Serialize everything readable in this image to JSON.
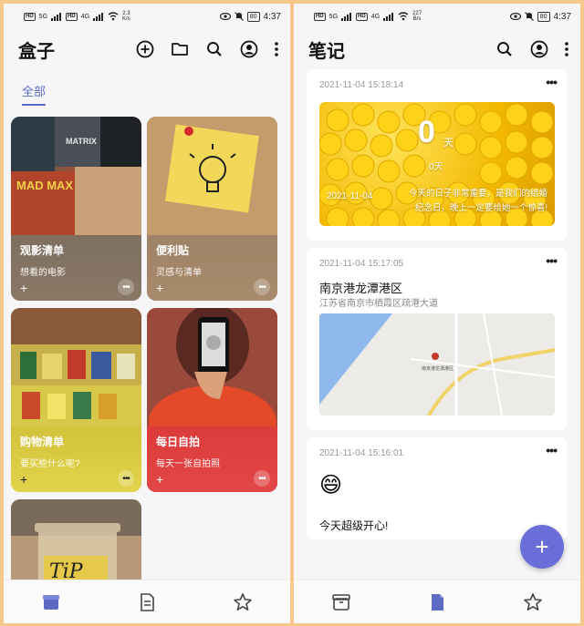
{
  "status_left": {
    "network_tag_1": "HD",
    "network_tag_2": "HD",
    "signal_1": "5G",
    "signal_2": "4G",
    "speed": "2.3",
    "speed_unit": "K/s",
    "speed_r": "227",
    "speed_unit_r": "B/s"
  },
  "status_right": {
    "battery": "80",
    "time": "4:37"
  },
  "left_app": {
    "title": "盒子",
    "tabs": [
      {
        "label": "全部"
      }
    ],
    "cards": [
      {
        "title": "观影清单",
        "subtitle": "想看的电影",
        "plus": "+",
        "more": "•••",
        "color": "#7e6f60"
      },
      {
        "title": "便利贴",
        "subtitle": "灵感与清单",
        "plus": "+",
        "more": "•••",
        "color": "#9f8366"
      },
      {
        "title": "购物清单",
        "subtitle": "要买些什么呢?",
        "plus": "+",
        "more": "•••",
        "color": "#cdbb3a"
      },
      {
        "title": "每日自拍",
        "subtitle": "每天一张自拍照",
        "plus": "+",
        "more": "•••",
        "color": "#dc3b3b"
      },
      {
        "title": "",
        "subtitle": "",
        "plus": "",
        "more": "",
        "color": "#8a7a64"
      }
    ],
    "icons": [
      "add-circle-icon",
      "folder-icon",
      "search-icon",
      "account-icon",
      "overflow-menu-icon"
    ],
    "nav": [
      "boxes-icon",
      "notes-icon",
      "star-icon"
    ],
    "card_image_text": {
      "tips": "TiP",
      "movie": "MATRIX",
      "movie2": "MAD MAX"
    }
  },
  "right_app": {
    "title": "笔记",
    "icons": [
      "search-icon",
      "account-icon",
      "overflow-menu-icon"
    ],
    "notes": [
      {
        "date": "2021-11-04 15:18:14",
        "more": "•••",
        "countdown": "0",
        "countdown_unit": "天",
        "countdown_sub": "0天",
        "overlay_date": "2021-11-04",
        "overlay_text_1": "今天的日子非常重要，是我们的结婚",
        "overlay_text_2": "纪念日，晚上一定要给她一个惊喜!"
      },
      {
        "date": "2021-11-04 15:17:05",
        "more": "•••",
        "title": "南京港龙潭港区",
        "address": "江苏省南京市栖霞区疏港大道",
        "map_label": "南京港龙潭港区"
      },
      {
        "date": "2021-11-04 15:16:01",
        "more": "•••",
        "emoji": "😄",
        "text": "今天超级开心!"
      }
    ],
    "fab": "+",
    "nav": [
      "boxes-icon",
      "notes-icon",
      "star-icon"
    ]
  },
  "colors": {
    "accent": "#5c6ac4",
    "fab": "#6a6ed8",
    "background": "#f6f6f8"
  }
}
